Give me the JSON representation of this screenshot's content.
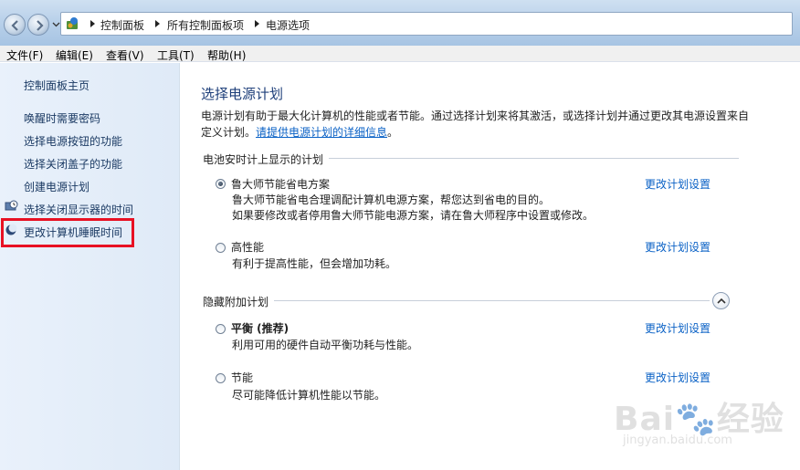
{
  "address_bar": {
    "breadcrumbs": [
      "控制面板",
      "所有控制面板项",
      "电源选项"
    ]
  },
  "menu": [
    "文件(F)",
    "编辑(E)",
    "查看(V)",
    "工具(T)",
    "帮助(H)"
  ],
  "sidebar": {
    "items": [
      {
        "label": "控制面板主页"
      },
      {
        "label": "唤醒时需要密码"
      },
      {
        "label": "选择电源按钮的功能"
      },
      {
        "label": "选择关闭盖子的功能"
      },
      {
        "label": "创建电源计划"
      },
      {
        "label": "选择关闭显示器的时间",
        "icon": "monitor-clock-icon"
      },
      {
        "label": "更改计算机睡眠时间",
        "icon": "moon-icon",
        "highlighted": true
      }
    ]
  },
  "main": {
    "title": "选择电源计划",
    "description": "电源计划有助于最大化计算机的性能或者节能。通过选择计划来将其激活，或选择计划并通过更改其电源设置来自定义计划。",
    "description_link": "请提供电源计划的详细信息",
    "description_end": "。",
    "sections": [
      {
        "title": "电池安时计上显示的计划",
        "plans": [
          {
            "name": "鲁大师节能省电方案",
            "selected": true,
            "bold": false,
            "desc": [
              "鲁大师节能省电合理调配计算机电源方案，帮您达到省电的目的。",
              "如果要修改或者停用鲁大师节能电源方案，请在鲁大师程序中设置或修改。"
            ],
            "link": "更改计划设置"
          },
          {
            "name": "高性能",
            "selected": false,
            "bold": false,
            "desc": [
              "有利于提高性能，但会增加功耗。"
            ],
            "link": "更改计划设置"
          }
        ]
      },
      {
        "title": "隐藏附加计划",
        "plans": [
          {
            "name": "平衡 (推荐)",
            "selected": false,
            "bold": true,
            "desc": [
              "利用可用的硬件自动平衡功耗与性能。"
            ],
            "link": "更改计划设置"
          },
          {
            "name": "节能",
            "selected": false,
            "bold": false,
            "desc": [
              "尽可能降低计算机性能以节能。"
            ],
            "link": "更改计划设置"
          }
        ]
      }
    ]
  },
  "watermark": {
    "line1": "Bai🐾经验",
    "line2": "jingyan.baidu.com"
  },
  "colors": {
    "link": "#0b62c6",
    "title": "#1e3f7a",
    "highlight": "#e81123",
    "sidebar_text": "#1b3a63"
  }
}
